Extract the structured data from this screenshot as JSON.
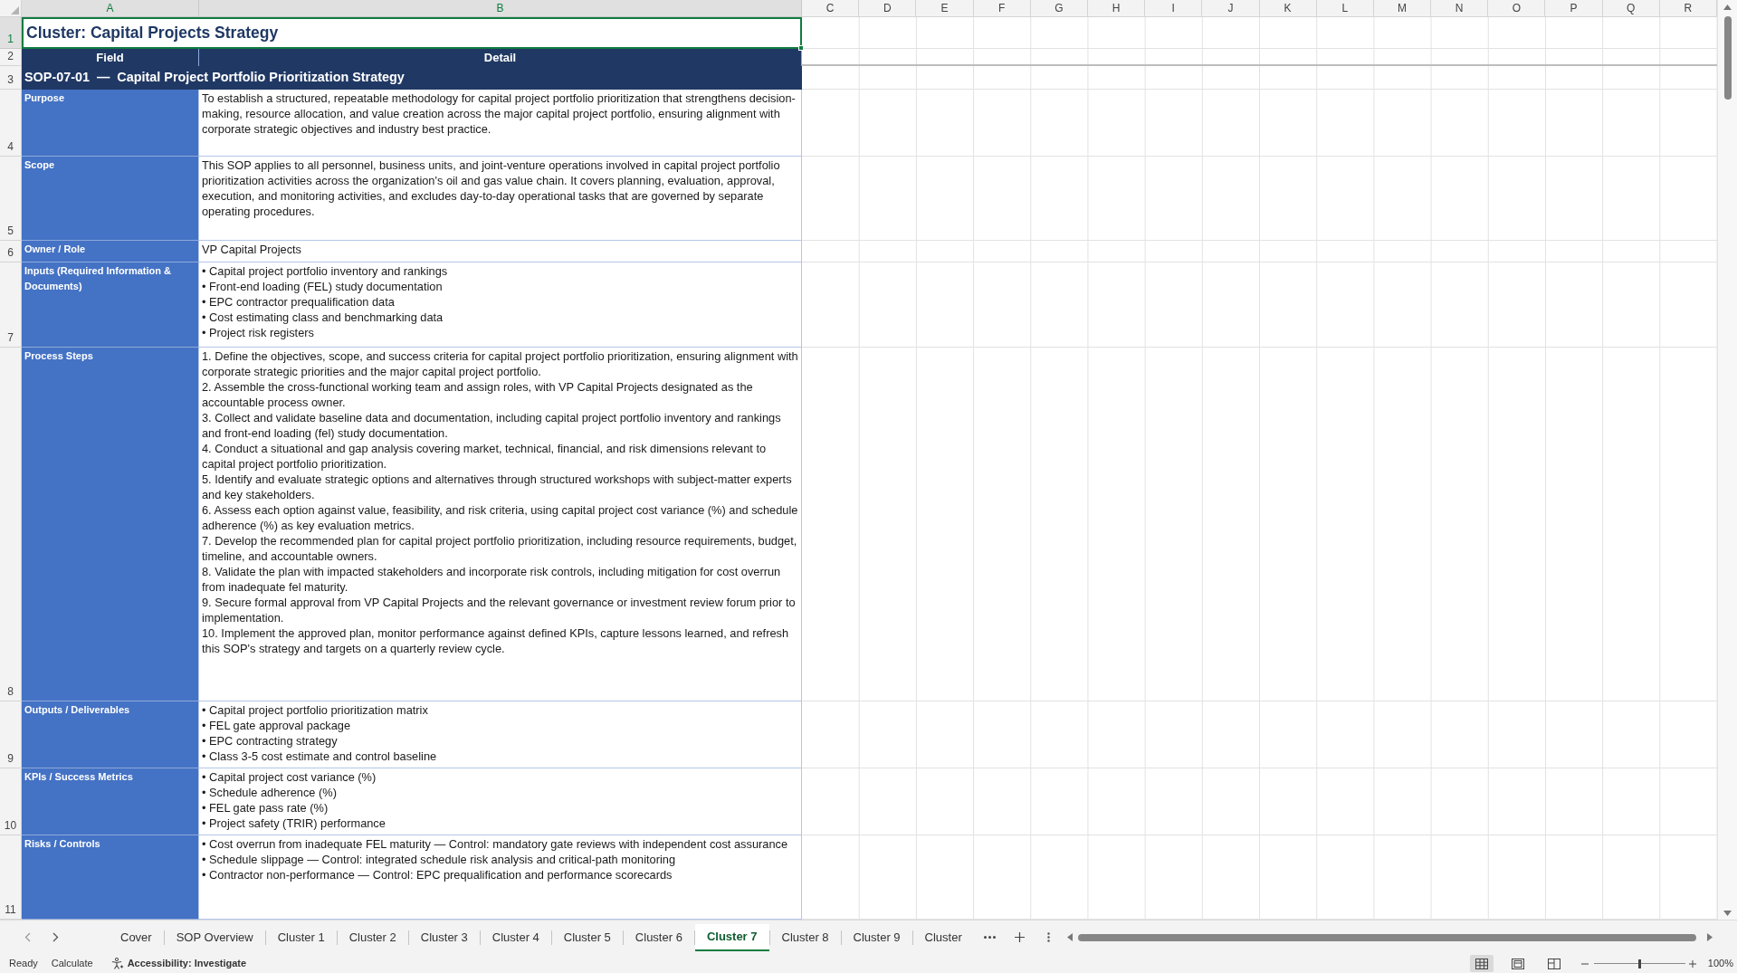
{
  "column_headers": [
    {
      "label": "A",
      "selected": true
    },
    {
      "label": "B",
      "selected": true
    },
    {
      "label": "C",
      "selected": false
    },
    {
      "label": "D",
      "selected": false
    },
    {
      "label": "E",
      "selected": false
    },
    {
      "label": "F",
      "selected": false
    },
    {
      "label": "G",
      "selected": false
    },
    {
      "label": "H",
      "selected": false
    },
    {
      "label": "I",
      "selected": false
    },
    {
      "label": "J",
      "selected": false
    },
    {
      "label": "K",
      "selected": false
    },
    {
      "label": "L",
      "selected": false
    },
    {
      "label": "M",
      "selected": false
    },
    {
      "label": "N",
      "selected": false
    },
    {
      "label": "O",
      "selected": false
    },
    {
      "label": "P",
      "selected": false
    },
    {
      "label": "Q",
      "selected": false
    },
    {
      "label": "R",
      "selected": false
    }
  ],
  "row_headers": [
    {
      "label": "1",
      "selected": true
    },
    {
      "label": "2",
      "selected": false
    },
    {
      "label": "3",
      "selected": false
    },
    {
      "label": "4",
      "selected": false
    },
    {
      "label": "5",
      "selected": false
    },
    {
      "label": "6",
      "selected": false
    },
    {
      "label": "7",
      "selected": false
    },
    {
      "label": "8",
      "selected": false
    },
    {
      "label": "9",
      "selected": false
    },
    {
      "label": "10",
      "selected": false
    },
    {
      "label": "11",
      "selected": false
    }
  ],
  "title_cell": {
    "text": "Cluster: Capital Projects Strategy",
    "selected": true
  },
  "table": {
    "columns": [
      "Field",
      "Detail"
    ],
    "section_heading": "SOP-07-01  —  Capital Project Portfolio Prioritization Strategy",
    "rows": [
      {
        "field": "Purpose",
        "kind": "text",
        "text": "To establish a structured, repeatable methodology for capital project portfolio prioritization that strengthens decision-making, resource allocation, and value creation across the major capital project portfolio, ensuring alignment with corporate strategic objectives and industry best practice."
      },
      {
        "field": "Scope",
        "kind": "text",
        "text": "This SOP applies to all personnel, business units, and joint-venture operations involved in capital project portfolio prioritization activities across the organization's oil and gas value chain. It covers planning, evaluation, approval, execution, and monitoring activities, and excludes day-to-day operational tasks that are governed by separate operating procedures."
      },
      {
        "field": "Owner / Role",
        "kind": "text",
        "text": "VP Capital Projects"
      },
      {
        "field": "Inputs (Required Information & Documents)",
        "kind": "list",
        "items": [
          "• Capital project portfolio inventory and rankings",
          "• Front-end loading (FEL) study documentation",
          "• EPC contractor prequalification data",
          "• Cost estimating class and benchmarking data",
          "• Project risk registers"
        ]
      },
      {
        "field": "Process Steps",
        "kind": "list",
        "items": [
          "1. Define the objectives, scope, and success criteria for capital project portfolio prioritization, ensuring alignment with corporate strategic priorities and the major capital project portfolio.",
          "2. Assemble the cross-functional working team and assign roles, with VP Capital Projects designated as the accountable process owner.",
          "3. Collect and validate baseline data and documentation, including capital project portfolio inventory and rankings and front-end loading (fel) study documentation.",
          "4. Conduct a situational and gap analysis covering market, technical, financial, and risk dimensions relevant to capital project portfolio prioritization.",
          "5. Identify and evaluate strategic options and alternatives through structured workshops with subject-matter experts and key stakeholders.",
          "6. Assess each option against value, feasibility, and risk criteria, using capital project cost variance (%) and schedule adherence (%) as key evaluation metrics.",
          "7. Develop the recommended plan for capital project portfolio prioritization, including resource requirements, budget, timeline, and accountable owners.",
          "8. Validate the plan with impacted stakeholders and incorporate risk controls, including mitigation for cost overrun from inadequate fel maturity.",
          "9. Secure formal approval from VP Capital Projects and the relevant governance or investment review forum prior to implementation.",
          "10. Implement the approved plan, monitor performance against defined KPIs, capture lessons learned, and refresh this SOP's strategy and targets on a quarterly review cycle."
        ]
      },
      {
        "field": "Outputs / Deliverables",
        "kind": "list",
        "items": [
          "• Capital project portfolio prioritization matrix",
          "• FEL gate approval package",
          "• EPC contracting strategy",
          "• Class 3-5 cost estimate and control baseline"
        ]
      },
      {
        "field": "KPIs / Success Metrics",
        "kind": "list",
        "items": [
          "• Capital project cost variance (%)",
          "• Schedule adherence (%)",
          "• FEL gate pass rate (%)",
          "• Project safety (TRIR) performance"
        ]
      },
      {
        "field": "Risks / Controls",
        "kind": "list",
        "items": [
          "• Cost overrun from inadequate FEL maturity — Control: mandatory gate reviews with independent cost assurance",
          "• Schedule slippage — Control: integrated schedule risk analysis and critical-path monitoring",
          "• Contractor non-performance — Control: EPC prequalification and performance scorecards"
        ]
      }
    ]
  },
  "sheet_tabs": [
    {
      "label": "Cover",
      "selected": false
    },
    {
      "label": "SOP Overview",
      "selected": false
    },
    {
      "label": "Cluster 1",
      "selected": false
    },
    {
      "label": "Cluster 2",
      "selected": false
    },
    {
      "label": "Cluster 3",
      "selected": false
    },
    {
      "label": "Cluster 4",
      "selected": false
    },
    {
      "label": "Cluster 5",
      "selected": false
    },
    {
      "label": "Cluster 6",
      "selected": false
    },
    {
      "label": "Cluster 7",
      "selected": true
    },
    {
      "label": "Cluster 8",
      "selected": false
    },
    {
      "label": "Cluster 9",
      "selected": false
    },
    {
      "label": "Cluster",
      "selected": false
    }
  ],
  "status_bar": {
    "mode": "Ready",
    "calculate": "Calculate",
    "accessibility": "Accessibility: Investigate",
    "views": [
      {
        "kind": "normal",
        "selected": true
      },
      {
        "kind": "page_layout",
        "selected": false
      },
      {
        "kind": "page_break",
        "selected": false
      }
    ],
    "zoom_slider": {
      "level": 0.5
    },
    "zoom": "100%"
  }
}
